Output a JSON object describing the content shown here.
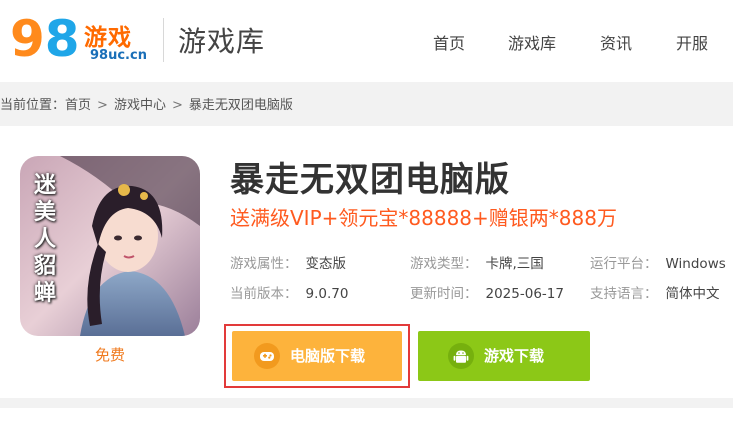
{
  "header": {
    "logo_text": "游戏",
    "logo_url": "98uc.cn",
    "section_title": "游戏库",
    "nav": [
      {
        "label": "首页"
      },
      {
        "label": "游戏库"
      },
      {
        "label": "资讯"
      },
      {
        "label": "开服"
      }
    ]
  },
  "breadcrumb": {
    "prefix": "当前位置：",
    "items": [
      "首页",
      "游戏中心",
      "暴走无双团电脑版"
    ],
    "separator": ">"
  },
  "game": {
    "cover_text": "迷美人貂蝉",
    "price": "免费",
    "title": "暴走无双团电脑版",
    "promo": "送满级VIP+领元宝*88888+赠银两*888万",
    "meta": {
      "attr_label": "游戏属性：",
      "attr_value": "变态版",
      "type_label": "游戏类型：",
      "type_value": "卡牌,三国",
      "platform_label": "运行平台：",
      "platform_value": "Windows",
      "version_label": "当前版本：",
      "version_value": "9.0.70",
      "updated_label": "更新时间：",
      "updated_value": "2025-06-17",
      "lang_label": "支持语言：",
      "lang_value": "简体中文"
    },
    "buttons": {
      "pc_download": "电脑版下载",
      "game_download": "游戏下载"
    }
  },
  "colors": {
    "promo": "#ff5a1f",
    "pc_button": "#fdb33c",
    "game_button": "#8cc817",
    "highlight_outline": "#e23a3a"
  }
}
